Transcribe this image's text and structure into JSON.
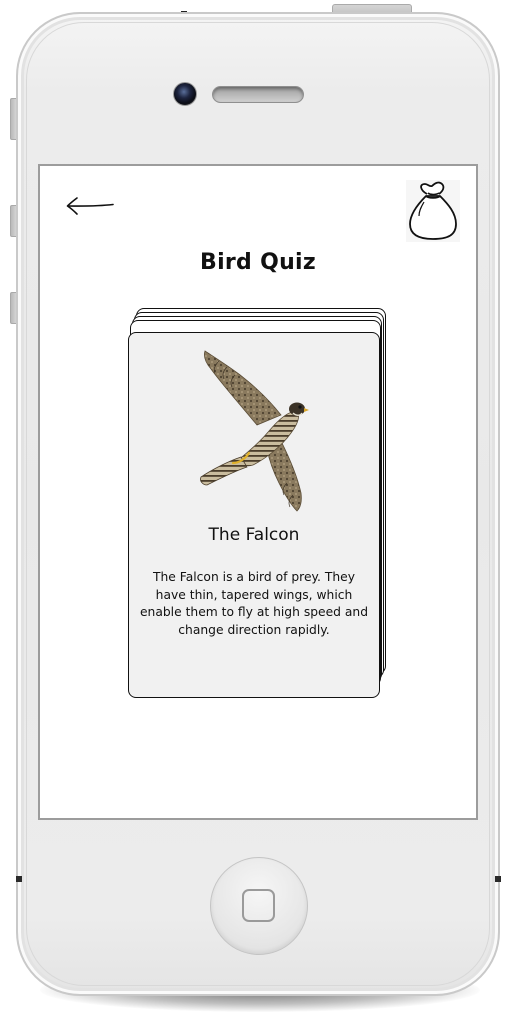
{
  "app": {
    "title": "Bird Quiz"
  },
  "header": {
    "back_icon": "back-arrow-icon",
    "bag_icon": "bag-icon"
  },
  "card": {
    "title": "The Falcon",
    "description": "The Falcon is a bird of prey. They have thin, tapered wings, which enable them to fly at high speed and change direction rapidly.",
    "image": "falcon-image"
  },
  "device": {
    "home_icon": "home-button-icon"
  },
  "colors": {
    "screen_background": "#ffffff",
    "card_background": "#f1f1f1",
    "ink": "#111111",
    "phone_body": "#ececec"
  }
}
